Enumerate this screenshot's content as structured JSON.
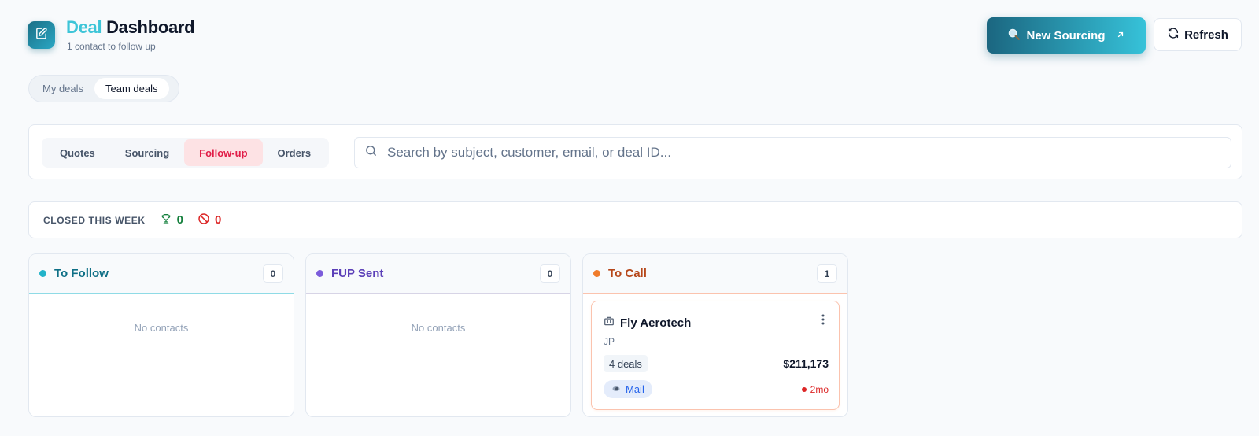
{
  "header": {
    "title_accent": "Deal",
    "title_rest": "Dashboard",
    "subtitle": "1 contact to follow up",
    "logo_icon": "edit-note-icon",
    "new_sourcing_label": "New Sourcing",
    "refresh_label": "Refresh",
    "accent_color": "#36c2d9"
  },
  "scope": {
    "options": [
      "My deals",
      "Team deals"
    ],
    "selected": "Team deals"
  },
  "tabs": {
    "items": [
      "Quotes",
      "Sourcing",
      "Follow-up",
      "Orders"
    ],
    "active": "Follow-up"
  },
  "search": {
    "placeholder": "Search by subject, customer, email, or deal ID...",
    "value": ""
  },
  "closed_this_week": {
    "label": "CLOSED THIS WEEK",
    "won": "0",
    "lost": "0"
  },
  "columns": [
    {
      "title": "To Follow",
      "count": "0",
      "empty_text": "No contacts",
      "color": "#22b3c9"
    },
    {
      "title": "FUP Sent",
      "count": "0",
      "empty_text": "No contacts",
      "color": "#7c5cdb"
    },
    {
      "title": "To Call",
      "count": "1",
      "color": "#f07c2c"
    }
  ],
  "contact_card": {
    "name": "Fly Aerotech",
    "country": "JP",
    "deals": "4 deals",
    "amount": "$211,173",
    "channel": "Mail",
    "age": "2mo"
  }
}
